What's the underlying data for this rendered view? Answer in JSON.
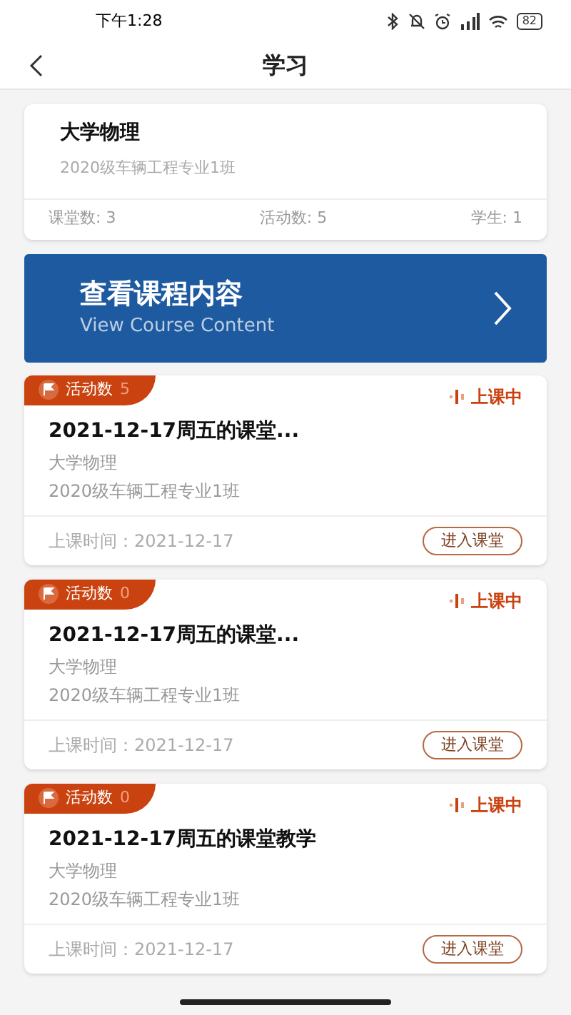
{
  "status_bar": {
    "time": "下午1:28",
    "battery": "82"
  },
  "header": {
    "title": "学习"
  },
  "course": {
    "name": "大学物理",
    "class_name": "2020级车辆工程专业1班",
    "stats": [
      "课堂数: 3",
      "活动数: 5",
      "学生: 1"
    ]
  },
  "banner": {
    "title": "查看课程内容",
    "subtitle": "View Course Content"
  },
  "sessions": [
    {
      "activity_label": "活动数",
      "activity_count": "5",
      "status": "上课中",
      "title": "2021-12-17周五的课堂...",
      "course": "大学物理",
      "class_name": "2020级车辆工程专业1班",
      "time": "上课时间：2021-12-17",
      "button": "进入课堂"
    },
    {
      "activity_label": "活动数",
      "activity_count": "0",
      "status": "上课中",
      "title": "2021-12-17周五的课堂...",
      "course": "大学物理",
      "class_name": "2020级车辆工程专业1班",
      "time": "上课时间：2021-12-17",
      "button": "进入课堂"
    },
    {
      "activity_label": "活动数",
      "activity_count": "0",
      "status": "上课中",
      "title": "2021-12-17周五的课堂教学",
      "course": "大学物理",
      "class_name": "2020级车辆工程专业1班",
      "time": "上课时间：2021-12-17",
      "button": "进入课堂"
    }
  ]
}
